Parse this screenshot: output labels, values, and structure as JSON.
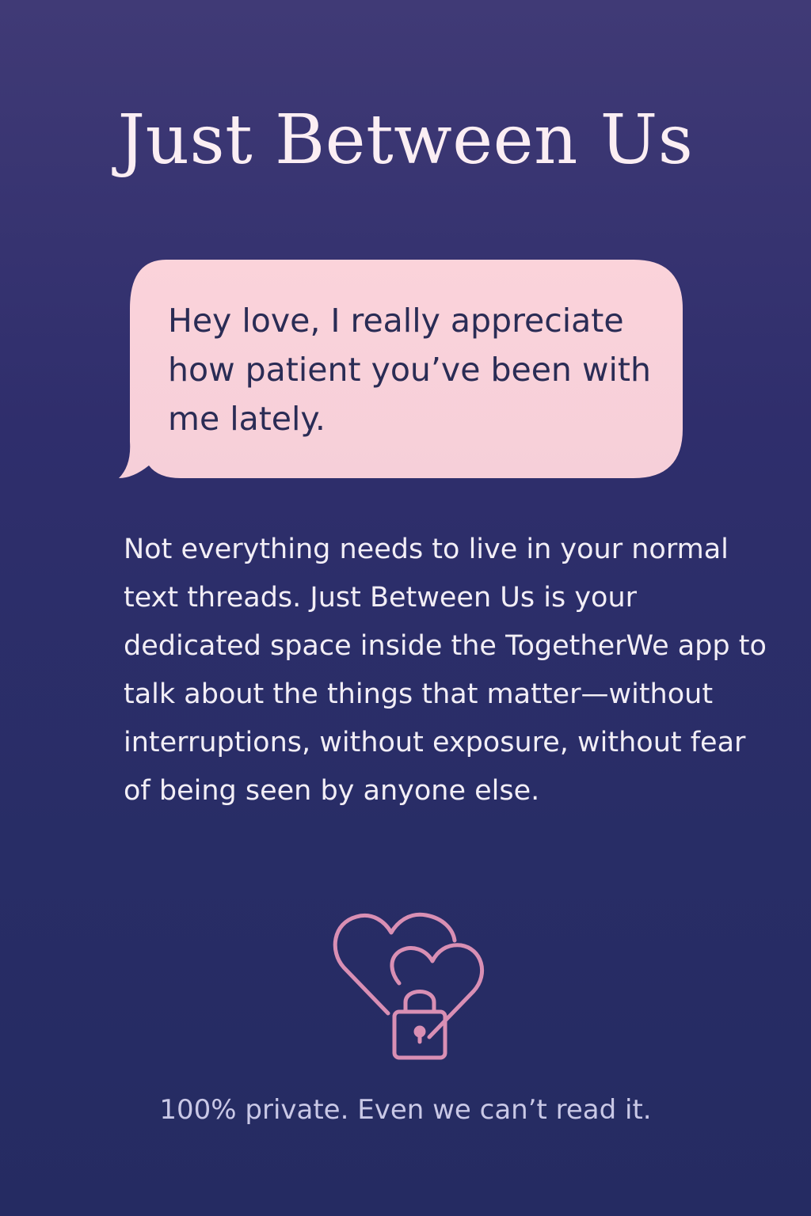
{
  "title": "Just Between Us",
  "message_bubble": {
    "text": "Hey love, I really appreciate how patient you’ve been with me lately."
  },
  "description": "Not everything needs to live in your normal text threads. Just Between Us is your dedicated space inside the TogetherWe app to talk about the things that matter—without interruptions, without exposure, without fear of being seen by anyone else.",
  "icon": {
    "name": "hearts-lock-icon",
    "color": "#d98fb4"
  },
  "footer": "100% private. Even we can’t read it.",
  "colors": {
    "background_top": "#403a76",
    "background_bottom": "#252b62",
    "bubble_fill": "#f9d1da",
    "bubble_text": "#2a2c55",
    "title": "#fbeef3",
    "body_text": "#f2eef6",
    "footer_text": "#c9c8e6"
  }
}
